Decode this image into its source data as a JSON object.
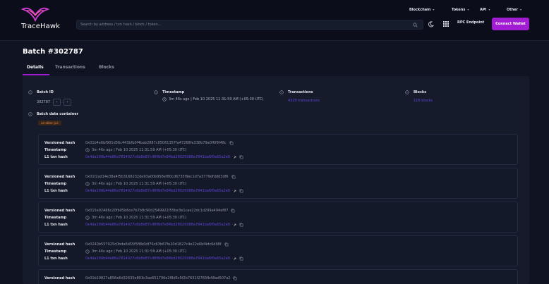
{
  "header": {
    "brand": "TraceHawk",
    "search_placeholder": "Search by address / txn hash / block / token...",
    "nav": [
      {
        "label": "Blockchain"
      },
      {
        "label": "Tokens"
      },
      {
        "label": "API"
      },
      {
        "label": "Other"
      }
    ],
    "rpc_label": "RPC Endpoint",
    "connect_label": "Connect Wallet",
    "colors": {
      "accent": "#a11dd1",
      "link": "#5e47d8"
    }
  },
  "page": {
    "title": "Batch #302787",
    "tabs": [
      {
        "label": "Details"
      },
      {
        "label": "Transactions"
      },
      {
        "label": "Blocks"
      }
    ]
  },
  "details": {
    "batch_id_label": "Batch ID",
    "batch_id_value": "302787",
    "prev_icon": "chevron-left-icon",
    "next_icon": "chevron-right-icon",
    "timestamp_label": "Timestamp",
    "timestamp_value": "3m 46s ago | Feb 10 2025 11:31:59 AM (+05:30 UTC)",
    "transactions_label": "Transactions",
    "transactions_value": "4329 transactions",
    "blocks_label": "Blocks",
    "blocks_value": "116 blocks",
    "container_label": "Batch data container",
    "container_tag": "ue-eblen jus",
    "row_labels": {
      "hash": "Versioned hash",
      "time": "Timestamp",
      "l1": "L1 txn hash"
    },
    "blobs": [
      {
        "hash": "0x01b4e6bf901d56c443bfb0f4bab2887c85061357fa47268fe338b79a0f6f9f48c",
        "time": "3m 46s ago | Feb 10 2025 11:31:59 AM (+05:30 UTC)",
        "l1": "0x4da169b44e86a7814027c6b8d87c48f8d7e84bd26025088a7641ba6f0a65a2e9"
      },
      {
        "hash": "0x01f2ad14e38a4f5b3168232de93a00b958ef80cd6735f9ec1d7a3779dfdd63df6",
        "time": "3m 46s ago | Feb 10 2025 11:31:59 AM (+05:30 UTC)",
        "l1": "0x4da169b44e86a7814027c6b8d87c48f8d7e84bd26025088a7641ba6f0a65a2e9"
      },
      {
        "hash": "0x015e92466c20fb05b6ce7b7b8c90d2549922f55be3e1cae22dc1d299e494ef87",
        "time": "3m 46s ago | Feb 10 2025 11:31:59 AM (+05:30 UTC)",
        "l1": "0x4da169b44e86a7814027c6b8d87c48f8d7e84bd26025088a7641ba6f0a65a2e9"
      },
      {
        "hash": "0x0240b557025c0bda6d55f5f8b0df76c63b67fe20d1827c4e22e6bf4dc6d98f",
        "time": "3m 46s ago | Feb 10 2025 11:31:59 AM (+05:30 UTC)",
        "l1": "0x4da169b44e86a7814027c6b8d87c48f8d7e84bd26025088a7641ba6f0a65a2e9"
      },
      {
        "hash": "0x01b19827a856e6d32635e803c3ae651796e2f8d5c5f2b7631f2783fb48ad507a2",
        "time": "",
        "l1": ""
      }
    ]
  }
}
